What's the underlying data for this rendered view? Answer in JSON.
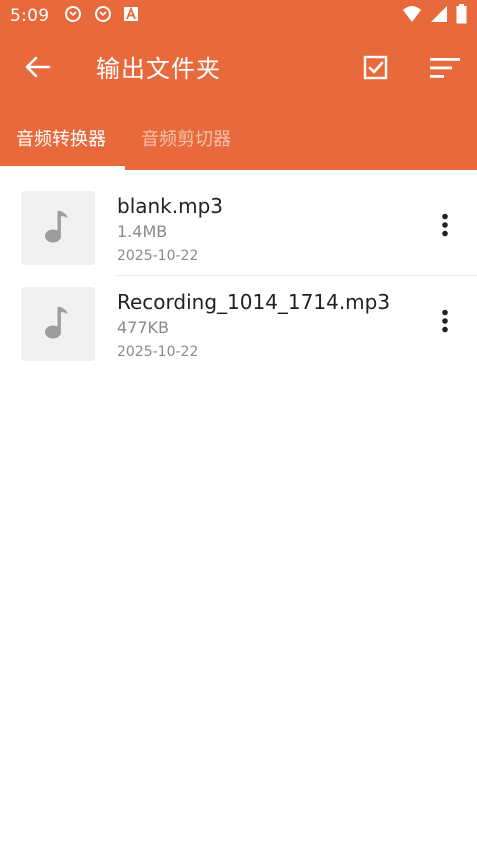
{
  "status_bar": {
    "time": "5:09",
    "icons_left": [
      "sync-icon",
      "sync-icon",
      "font-a-icon"
    ],
    "icons_right": [
      "wifi-icon",
      "signal-icon",
      "battery-icon"
    ]
  },
  "app_bar": {
    "title": "输出文件夹",
    "back_icon": "arrow-left-icon",
    "select_icon": "checkbox-icon",
    "sort_icon": "sort-icon"
  },
  "tabs": [
    {
      "label": "音频转换器",
      "active": true
    },
    {
      "label": "音频剪切器",
      "active": false
    }
  ],
  "files": [
    {
      "name": "blank.mp3",
      "size": "1.4MB",
      "date": "2025-10-22",
      "icon": "music-note-icon"
    },
    {
      "name": "Recording_1014_1714.mp3",
      "size": "477KB",
      "date": "2025-10-22",
      "icon": "music-note-icon"
    }
  ],
  "colors": {
    "accent": "#e8693b",
    "tab_inactive": "#f6c3ad",
    "thumb_bg": "#f1f1f1",
    "text_primary": "#222222",
    "text_secondary": "#8a8a8a"
  }
}
